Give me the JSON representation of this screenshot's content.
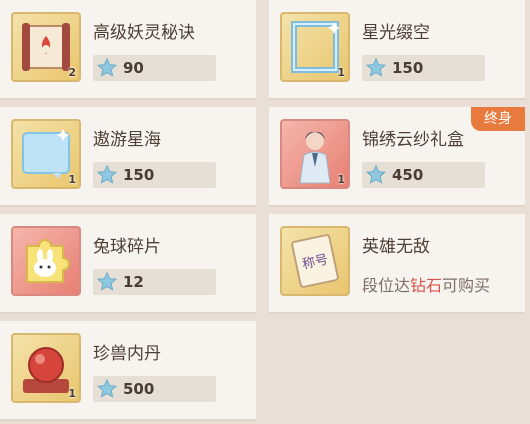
{
  "items": [
    {
      "title": "高级妖灵秘诀",
      "qty": "2",
      "price": "90",
      "icon": "scroll-icon",
      "bg": "gold"
    },
    {
      "title": "星光缀空",
      "qty": "1",
      "price": "150",
      "icon": "frame-icon",
      "bg": "gold"
    },
    {
      "title": "遨游星海",
      "qty": "1",
      "price": "150",
      "icon": "chat-bubble-icon",
      "bg": "gold"
    },
    {
      "title": "锦绣云纱礼盒",
      "qty": "1",
      "price": "450",
      "icon": "avatar-outfit-icon",
      "bg": "red",
      "badge": "终身"
    },
    {
      "title": "兔球碎片",
      "qty": "",
      "price": "12",
      "icon": "puzzle-piece-icon",
      "bg": "red"
    },
    {
      "title": "英雄无敌",
      "qty": "",
      "icon": "title-scroll-icon",
      "bg": "gold",
      "condition": {
        "prefix": "段位达",
        "highlight": "钻石",
        "suffix": "可购买"
      },
      "icon_text": "称号"
    },
    {
      "title": "珍兽内丹",
      "qty": "1",
      "price": "500",
      "icon": "red-orb-icon",
      "bg": "gold"
    }
  ],
  "colors": {
    "star": "#8ec8e0",
    "badge": "#e87a3e",
    "highlight": "#d6544d"
  }
}
